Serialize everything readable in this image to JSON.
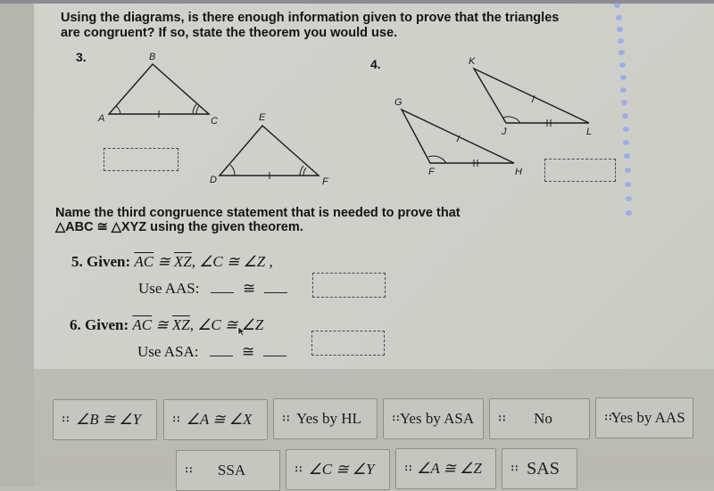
{
  "instructions": {
    "line1": "Using the diagrams, is there enough information given to prove that the triangles",
    "line2": "are congruent? If so, state the theorem you would use."
  },
  "problem3": {
    "number": "3.",
    "labels": {
      "A": "A",
      "B": "B",
      "C": "C",
      "D": "D",
      "E": "E",
      "F": "F"
    }
  },
  "problem4": {
    "number": "4.",
    "labels": {
      "K": "K",
      "J": "J",
      "L": "L",
      "G": "G",
      "F": "F",
      "H": "H"
    }
  },
  "section2": {
    "line1": "Name the third congruence statement that is needed to prove that",
    "line2": "△ABC ≅ △XYZ  using the given theorem."
  },
  "problem5": {
    "number": "5.",
    "given_label": "Given:",
    "seg1": "AC",
    "cong": "≅",
    "seg2": "XZ",
    "rest": ", ∠C ≅ ∠Z ,",
    "use_label": "Use AAS:",
    "cong_sym": "≅"
  },
  "problem6": {
    "number": "6.",
    "given_label": "Given:",
    "seg1": "AC",
    "cong": "≅",
    "seg2": "XZ",
    "rest": ", ∠C ≅ ∠Z",
    "use_label": "Use ASA:",
    "cong_sym": "≅"
  },
  "tiles": [
    {
      "label": "∠B ≅ ∠Y",
      "math": true
    },
    {
      "label": "∠A ≅ ∠X",
      "math": true
    },
    {
      "label": "Yes by HL",
      "math": false
    },
    {
      "label": "Yes by ASA",
      "math": false
    },
    {
      "label": "No",
      "math": false
    },
    {
      "label": "Yes by AAS",
      "math": false
    },
    {
      "label": "SSA",
      "math": false
    },
    {
      "label": "∠C ≅ ∠Y",
      "math": true
    },
    {
      "label": "∠A ≅ ∠Z",
      "math": true
    },
    {
      "label": "SAS",
      "math": false
    }
  ],
  "grip_icon": "∷"
}
